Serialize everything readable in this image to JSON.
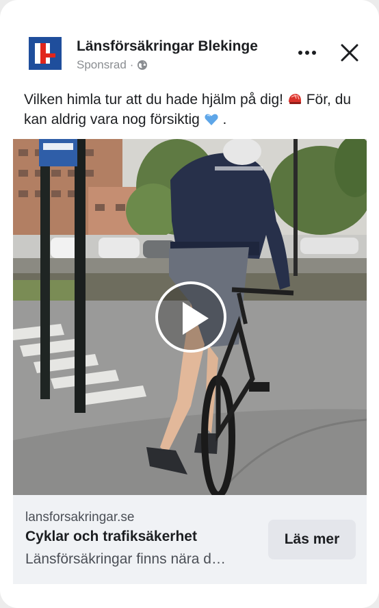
{
  "post": {
    "page_name": "Länsförsäkringar Blekinge",
    "sponsored_label": "Sponsrad",
    "separator": "·",
    "caption_part1": "Vilken himla tur att du hade hjälm på dig! ",
    "caption_part2": " För, du kan aldrig vara nog försiktig ",
    "caption_part3": ".",
    "caption_emojis": [
      "helmet-emoji",
      "blue-heart-emoji"
    ]
  },
  "media": {
    "type": "video",
    "play_icon": "play-icon"
  },
  "link": {
    "domain": "lansforsakringar.se",
    "title": "Cyklar och trafiksäkerhet",
    "description": "Länsförsäkringar finns nära d…",
    "cta_label": "Läs mer"
  },
  "icons": {
    "more": "more-options-icon",
    "close": "close-icon",
    "audience": "globe-icon"
  },
  "colors": {
    "brand_blue": "#1f4e9c",
    "brand_red": "#e1261c",
    "text_primary": "#1c1e21",
    "text_secondary": "#8a8d91",
    "link_bar_bg": "#f0f2f5",
    "button_bg": "#e4e6eb",
    "heart_blue": "#5ea6e8"
  }
}
